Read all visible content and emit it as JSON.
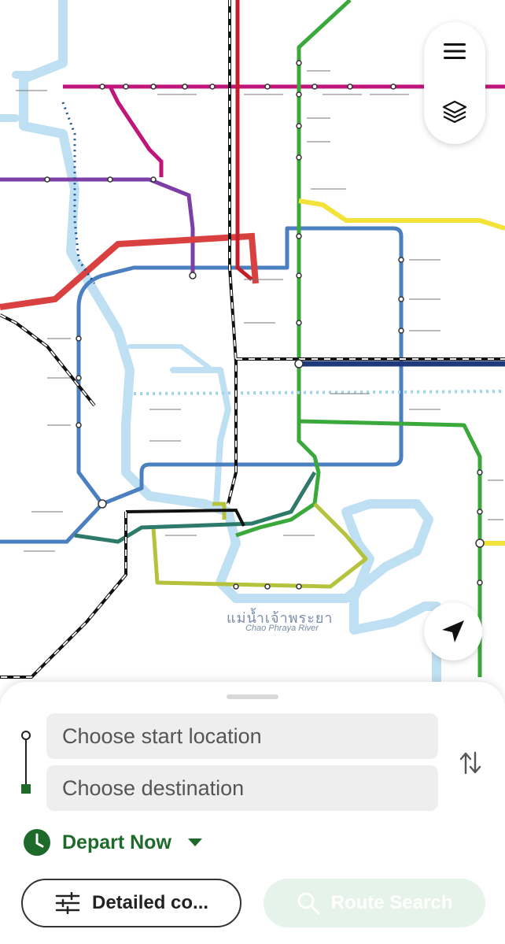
{
  "map": {
    "river_label_th": "แม่น้ำเจ้าพระยา",
    "river_label_en": "Chao Phraya River",
    "colors": {
      "blue_line": "#4a7fc0",
      "purple_line": "#7b3fa6",
      "magenta_line": "#c0157a",
      "green_line": "#3aa83a",
      "red_line": "#d94141",
      "dark_red_line": "#c41e2a",
      "yellow_line": "#f2e23a",
      "olive_line": "#b5c23c",
      "teal_line": "#2e7a6a",
      "river": "#bfe0f3",
      "rail": "#111111"
    }
  },
  "controls": {
    "menu_icon": "hamburger-icon",
    "layers_icon": "layers-icon",
    "locate_icon": "navigation-arrow-icon"
  },
  "sheet": {
    "start_placeholder": "Choose start location",
    "dest_placeholder": "Choose destination",
    "depart_label": "Depart Now",
    "detail_label": "Detailed co...",
    "search_label": "Route Search",
    "accent": "#1e6a2a"
  }
}
